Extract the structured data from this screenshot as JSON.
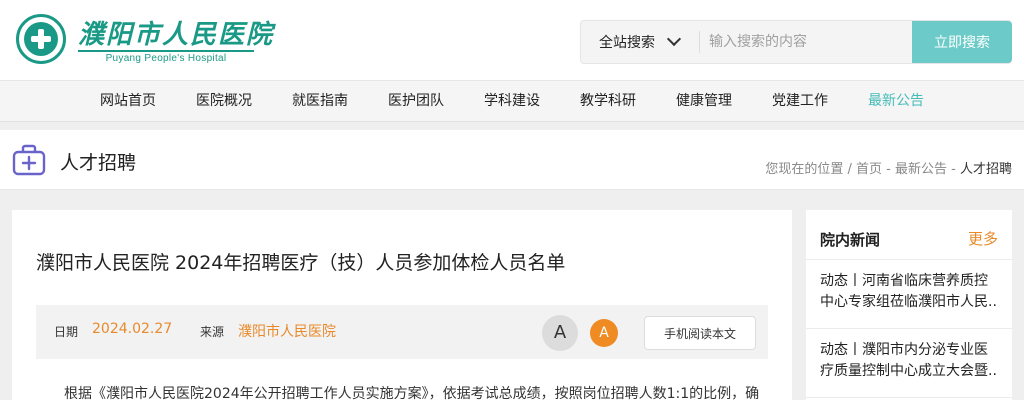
{
  "header": {
    "logo_cn": "濮阳市人民医院",
    "logo_en": "Puyang People's Hospital",
    "search": {
      "scope": "全站搜索",
      "placeholder": "输入搜索的内容",
      "button": "立即搜索"
    }
  },
  "nav": {
    "items": [
      "网站首页",
      "医院概况",
      "就医指南",
      "医护团队",
      "学科建设",
      "教学科研",
      "健康管理",
      "党建工作",
      "最新公告"
    ],
    "active_index": 8,
    "active_color": "#45bcb7"
  },
  "page": {
    "title": "人才招聘",
    "breadcrumb": {
      "prefix": "您现在的位置",
      "home": "首页",
      "section": "最新公告",
      "current": "人才招聘"
    }
  },
  "article": {
    "title": "濮阳市人民医院 2024年招聘医疗（技）人员参加体检人员名单",
    "meta": {
      "date_label": "日期",
      "date": "2024.02.27",
      "source_label": "来源",
      "source": "濮阳市人民医院",
      "font_large": "A",
      "font_small": "A",
      "mobile_read": "手机阅读本文"
    },
    "body_first_line": "根据《濮阳市人民医院2024年公开招聘工作人员实施方案》，依据考试总成绩，按照岗位招聘人数1:1的比例，确"
  },
  "sidebar": {
    "title": "院内新闻",
    "more": "更多",
    "items": [
      {
        "line1": "动态丨河南省临床营养质控",
        "line2": "中心专家组莅临濮阳市人民..."
      },
      {
        "line1": "动态丨濮阳市内分泌专业医",
        "line2": "疗质量控制中心成立大会暨..."
      }
    ]
  },
  "colors": {
    "brand": "#1a9a86",
    "search_button": "#6ccbc8",
    "accent_orange": "#e88a2a",
    "icon_purple": "#6a63c9"
  }
}
